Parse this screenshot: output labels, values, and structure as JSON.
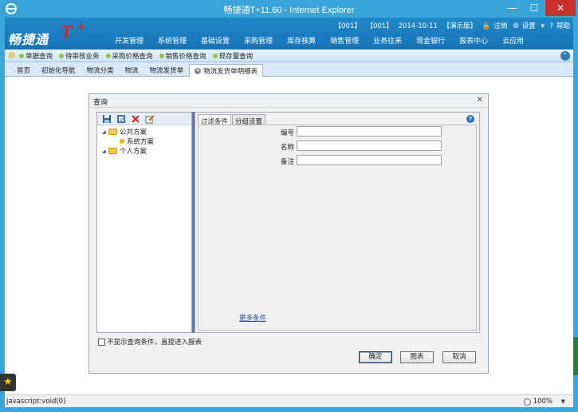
{
  "window": {
    "title": "畅捷通T+11.60 - Internet Explorer",
    "min": "—",
    "max": "☐",
    "close": "✕"
  },
  "header": {
    "logo_cn": "畅捷通",
    "logo_t": "T",
    "logo_plus": "+",
    "info": [
      "【001】",
      "【001】",
      "2014-10-11",
      "【演示版】",
      "注销",
      "设置",
      "帮助"
    ],
    "menu": [
      "开发管理",
      "系统管理",
      "基础设置",
      "采购管理",
      "库存核算",
      "销售管理",
      "业务往来",
      "现金银行",
      "报表中心",
      "云应用"
    ]
  },
  "quickbar": {
    "items": [
      "单据查询",
      "待审核业务",
      "采购价格查询",
      "销售价格查询",
      "现存量查询"
    ],
    "collapse": "⌃"
  },
  "tabs": [
    "首页",
    "初始化导航",
    "物流分类",
    "物流",
    "物流发货单",
    "物流发货单明细表"
  ],
  "dialog": {
    "title": "查询",
    "close": "✕",
    "tree": {
      "public": "公共方案",
      "system": "系统方案",
      "personal": "个人方案"
    },
    "filter_tabs": [
      "过滤条件",
      "分组设置"
    ],
    "fields": [
      {
        "label": "编号",
        "value": ""
      },
      {
        "label": "名称",
        "value": ""
      },
      {
        "label": "备注",
        "value": ""
      }
    ],
    "more": "更多条件",
    "no_show": "不显示查询条件，直接进入报表",
    "buttons": {
      "ok": "确定",
      "chart": "图表",
      "cancel": "取消"
    }
  },
  "status": {
    "text": "javascript:void(0)",
    "zoom": "100%"
  }
}
